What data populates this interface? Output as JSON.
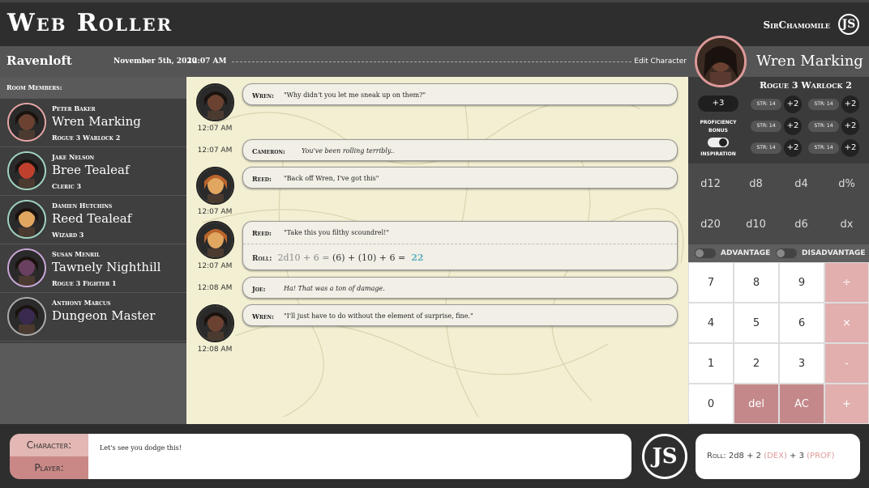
{
  "header": {
    "title": "Web Roller",
    "user": "SirChamomile",
    "logo": "JS"
  },
  "subheader": {
    "room": "Ravenloft",
    "date": "November 5th, 2020",
    "time": "12:07 AM",
    "edit": "Edit Character"
  },
  "sidebar": {
    "label": "Room Members:",
    "members": [
      {
        "player": "Peter Baker",
        "character": "Wren Marking",
        "class": "Rogue 3 Warlock 2",
        "color": "#e6a5a5",
        "skin": "#6b4232"
      },
      {
        "player": "Jake Nelson",
        "character": "Bree Tealeaf",
        "class": "Cleric 3",
        "color": "#9fd3c0",
        "skin": "#c0402e"
      },
      {
        "player": "Damien Hutchins",
        "character": "Reed Tealeaf",
        "class": "Wizard 3",
        "color": "#9fd3c0",
        "skin": "#e1a760"
      },
      {
        "player": "Susan Menril",
        "character": "Tawnely Nighthill",
        "class": "Rogue 3 Fighter 1",
        "color": "#c9a6d8",
        "skin": "#6a4060"
      },
      {
        "player": "Anthony Marcus",
        "character": "Dungeon Master",
        "class": "",
        "color": "#aaaaaa",
        "skin": "#3a2a50"
      }
    ]
  },
  "chat": {
    "messages": [
      {
        "who": "Wren:",
        "text": "\"Why didn't you let me sneak up on them?\"",
        "time": "12:07 AM",
        "italic": false
      },
      {
        "who": "Cameron:",
        "text": "You've been rolling terribly..",
        "time": "12:07 AM",
        "italic": true
      },
      {
        "who": "Reed:",
        "text": "\"Back off Wren, I've got this\"",
        "time": "12:07 AM",
        "italic": false
      },
      {
        "who": "Reed:",
        "text": "\"Take this you filthy scoundrel!\"",
        "time": "12:07 AM",
        "italic": false,
        "roll_label": "Roll:",
        "roll_formula": "2d10 + 6 =",
        "roll_expanded": "(6) + (10) + 6 =",
        "roll_total": "22"
      },
      {
        "who": "Joe:",
        "text": "Ha! That was a ton of damage.",
        "time": "12:08 AM",
        "italic": true
      },
      {
        "who": "Wren:",
        "text": "\"I'll just have to do without the element of surprise, fine.\"",
        "time": "12:08 AM",
        "italic": false
      }
    ]
  },
  "character": {
    "name": "Wren Marking",
    "class": "Rogue 3 Warlock 2",
    "proficiency": "+3",
    "prof_label_1": "PROFICIENCY",
    "prof_label_2": "BONUS",
    "inspiration": "INSPIRATION",
    "stats": [
      {
        "label": "STR: 14",
        "mod": "+2"
      },
      {
        "label": "STR: 14",
        "mod": "+2"
      },
      {
        "label": "STR: 14",
        "mod": "+2"
      },
      {
        "label": "STR: 14",
        "mod": "+2"
      },
      {
        "label": "STR: 14",
        "mod": "+2"
      },
      {
        "label": "STR: 14",
        "mod": "+2"
      }
    ]
  },
  "dice": [
    "d12",
    "d8",
    "d4",
    "d%",
    "d20",
    "d10",
    "d6",
    "dx"
  ],
  "advantage": "ADVANTAGE",
  "disadvantage": "DISADVANTAGE",
  "keypad": [
    "7",
    "8",
    "9",
    "÷",
    "4",
    "5",
    "6",
    "×",
    "1",
    "2",
    "3",
    "-",
    "0",
    "del",
    "AC",
    "+"
  ],
  "bottom": {
    "mode_character": "Character:",
    "mode_player": "Player:",
    "message": "Let's see you dodge this!",
    "logo": "JS",
    "roll_label": "Roll:",
    "roll_formula": "2d8 + 2",
    "roll_dex": "(DEX)",
    "roll_plus": "+ 3",
    "roll_prof": "(PROF)"
  }
}
